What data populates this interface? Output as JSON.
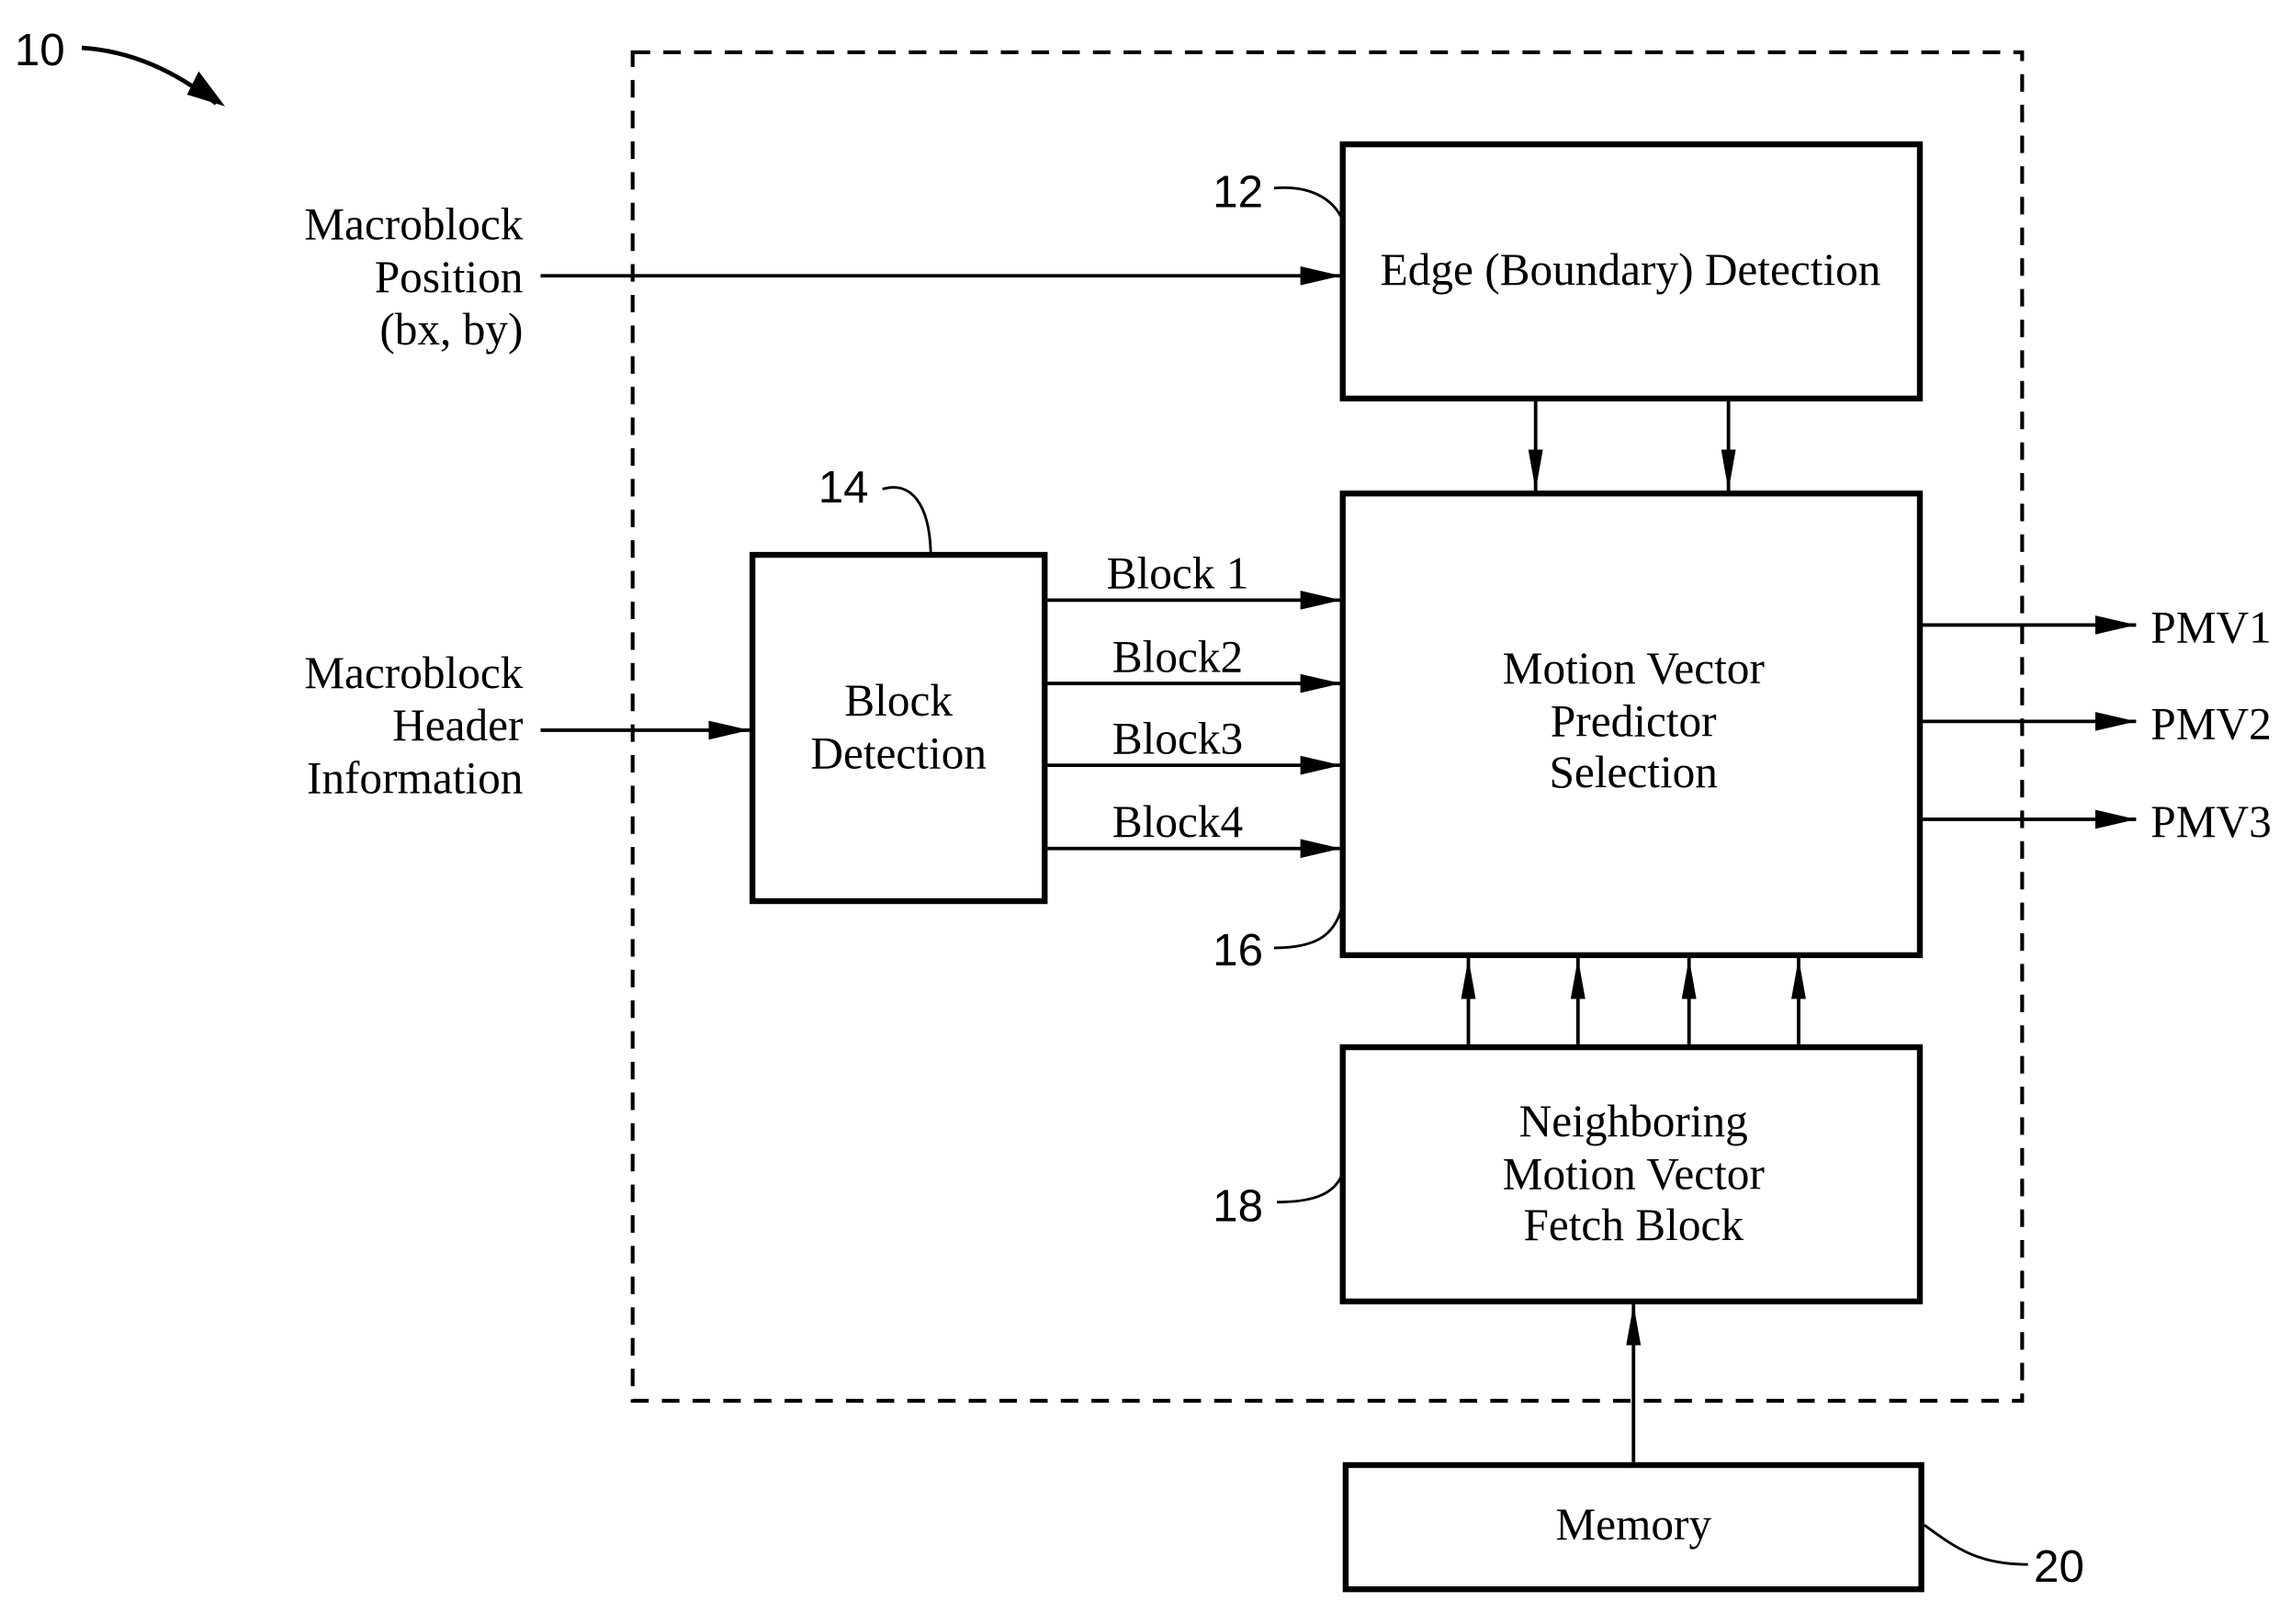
{
  "figure": {
    "ref_number": "10",
    "colors": {
      "ink": "#000000",
      "background": "#ffffff"
    }
  },
  "inputs": {
    "macroblock_position": [
      "Macroblock",
      "Position",
      "(bx, by)"
    ],
    "macroblock_header": [
      "Macroblock",
      "Header",
      "Information"
    ]
  },
  "blocks": {
    "edge_detection": {
      "ref": "12",
      "label": [
        "Edge (Boundary) Detection"
      ]
    },
    "block_detection": {
      "ref": "14",
      "label": [
        "Block",
        "Detection"
      ]
    },
    "mv_predictor_selection": {
      "ref": "16",
      "label": [
        "Motion Vector",
        "Predictor",
        "Selection"
      ]
    },
    "neighboring_mv_fetch": {
      "ref": "18",
      "label": [
        "Neighboring",
        "Motion Vector",
        "Fetch Block"
      ]
    },
    "memory": {
      "ref": "20",
      "label": [
        "Memory"
      ]
    }
  },
  "signals": {
    "block_outputs": [
      "Block 1",
      "Block2",
      "Block3",
      "Block4"
    ],
    "outputs": [
      "PMV1",
      "PMV2",
      "PMV3"
    ]
  }
}
